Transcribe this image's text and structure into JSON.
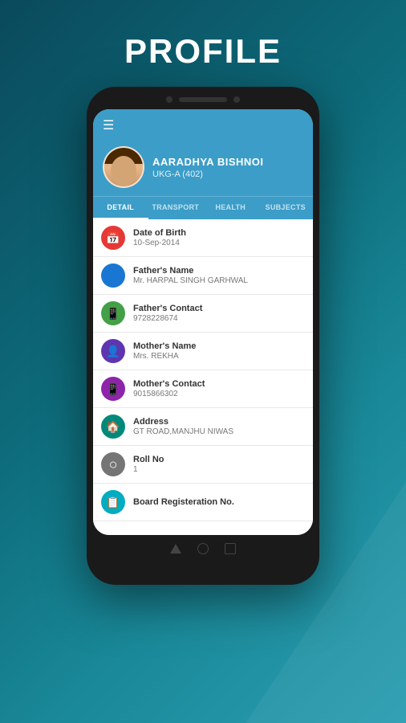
{
  "page": {
    "title": "PROFILE",
    "background_colors": [
      "#0a4a5c",
      "#2a9db0"
    ]
  },
  "phone": {
    "screen": {
      "header": {
        "hamburger": "☰"
      },
      "profile": {
        "name": "AARADHYA BISHNOI",
        "class": "UKG-A (402)"
      },
      "tabs": [
        {
          "label": "DETAIL",
          "active": true
        },
        {
          "label": "TRANSPORT",
          "active": false
        },
        {
          "label": "HEALTH",
          "active": false
        },
        {
          "label": "SUBJECTS",
          "active": false
        }
      ],
      "list_items": [
        {
          "icon_color": "red",
          "icon": "📅",
          "label": "Date of Birth",
          "value": "10-Sep-2014"
        },
        {
          "icon_color": "blue",
          "icon": "👤",
          "label": "Father's Name",
          "value": "Mr. HARPAL SINGH GARHWAL"
        },
        {
          "icon_color": "green",
          "icon": "📱",
          "label": "Father's Contact",
          "value": "9728228674"
        },
        {
          "icon_color": "purple-dark",
          "icon": "👤",
          "label": "Mother's Name",
          "value": "Mrs. REKHA"
        },
        {
          "icon_color": "purple",
          "icon": "📱",
          "label": "Mother's Contact",
          "value": "9015866302"
        },
        {
          "icon_color": "teal",
          "icon": "🏠",
          "label": "Address",
          "value": "GT ROAD,MANJHU NIWAS"
        },
        {
          "icon_color": "gray",
          "icon": "○",
          "label": "Roll No",
          "value": "1"
        },
        {
          "icon_color": "cyan",
          "icon": "📋",
          "label": "Board Registeration No.",
          "value": ""
        }
      ]
    }
  }
}
